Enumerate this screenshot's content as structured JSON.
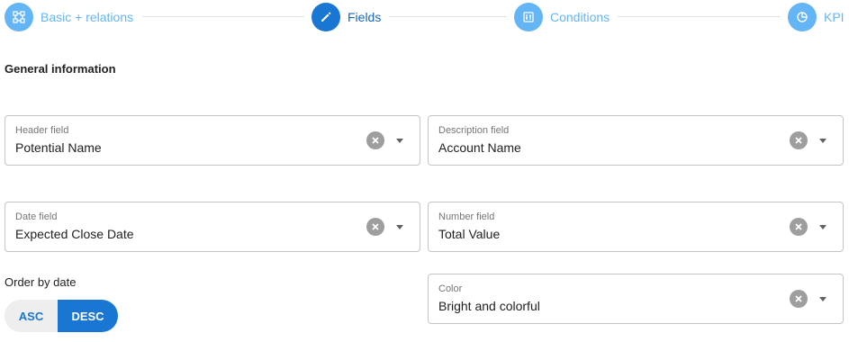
{
  "stepper": {
    "steps": [
      {
        "label": "Basic + relations",
        "state": "done",
        "icon": "relations-icon"
      },
      {
        "label": "Fields",
        "state": "active",
        "icon": "pencil-icon"
      },
      {
        "label": "Conditions",
        "state": "done",
        "icon": "conditions-icon"
      },
      {
        "label": "KPI",
        "state": "done",
        "icon": "pie-chart-icon"
      }
    ]
  },
  "section": {
    "title": "General information"
  },
  "fields": {
    "header": {
      "label": "Header field",
      "value": "Potential Name"
    },
    "description": {
      "label": "Description field",
      "value": "Account Name"
    },
    "date": {
      "label": "Date field",
      "value": "Expected Close Date"
    },
    "number": {
      "label": "Number field",
      "value": "Total Value"
    },
    "color": {
      "label": "Color",
      "value": "Bright and colorful"
    }
  },
  "order": {
    "label": "Order by date",
    "options": [
      "ASC",
      "DESC"
    ],
    "selected": "DESC"
  },
  "colors": {
    "primary": "#1976d2",
    "step_done": "#64b5f6",
    "border": "#c4c4c4",
    "clear_icon": "#9e9e9e"
  }
}
